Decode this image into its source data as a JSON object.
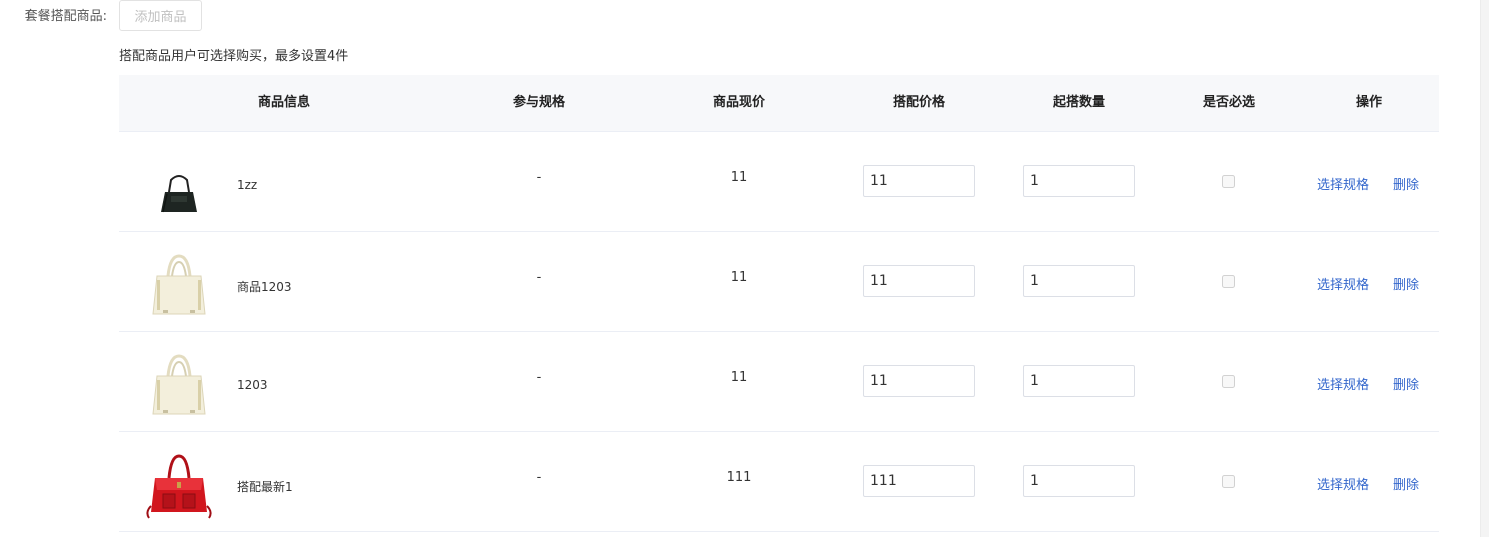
{
  "form": {
    "label": "套餐搭配商品:",
    "add_button_label": "添加商品",
    "hint": "搭配商品用户可选择购买，最多设置4件"
  },
  "table": {
    "headers": {
      "product": "商品信息",
      "spec": "参与规格",
      "price": "商品现价",
      "match_price": "搭配价格",
      "min_qty": "起搭数量",
      "required": "是否必选",
      "action": "操作"
    },
    "actions": {
      "select_spec": "选择规格",
      "delete": "删除"
    },
    "rows": [
      {
        "name": "1zz",
        "spec": "-",
        "price": "11",
        "match_price": "11",
        "min_qty": "1",
        "required": false,
        "image": "black-backpack"
      },
      {
        "name": "商品1203",
        "spec": "-",
        "price": "11",
        "match_price": "11",
        "min_qty": "1",
        "required": false,
        "image": "cream-handbag"
      },
      {
        "name": "1203",
        "spec": "-",
        "price": "11",
        "match_price": "11",
        "min_qty": "1",
        "required": false,
        "image": "cream-handbag"
      },
      {
        "name": "搭配最新1",
        "spec": "-",
        "price": "111",
        "match_price": "111",
        "min_qty": "1",
        "required": false,
        "image": "red-handbag"
      }
    ]
  },
  "colors": {
    "link": "#3366cc",
    "header_bg": "#f7f8fa",
    "border": "#ebeef5"
  }
}
